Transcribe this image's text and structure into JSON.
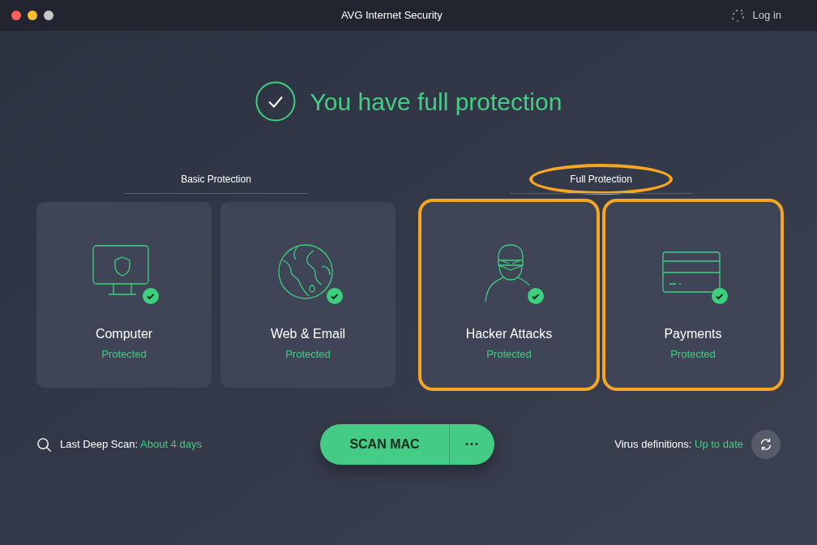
{
  "window": {
    "title": "AVG Internet Security",
    "login": "Log in"
  },
  "headline": "You have full protection",
  "groups": [
    {
      "label": "Basic Protection",
      "highlighted": false,
      "cards": [
        {
          "kind": "computer",
          "title": "Computer",
          "status": "Protected",
          "highlighted": false
        },
        {
          "kind": "globe",
          "title": "Web & Email",
          "status": "Protected",
          "highlighted": false
        }
      ]
    },
    {
      "label": "Full Protection",
      "highlighted": true,
      "cards": [
        {
          "kind": "hacker",
          "title": "Hacker Attacks",
          "status": "Protected",
          "highlighted": true
        },
        {
          "kind": "card",
          "title": "Payments",
          "status": "Protected",
          "highlighted": true
        }
      ]
    }
  ],
  "last_scan": {
    "label": "Last Deep Scan:",
    "value": "About 4 days"
  },
  "scan_button": {
    "label": "SCAN MAC",
    "more": "···"
  },
  "definitions": {
    "label": "Virus definitions:",
    "value": "Up to date"
  }
}
